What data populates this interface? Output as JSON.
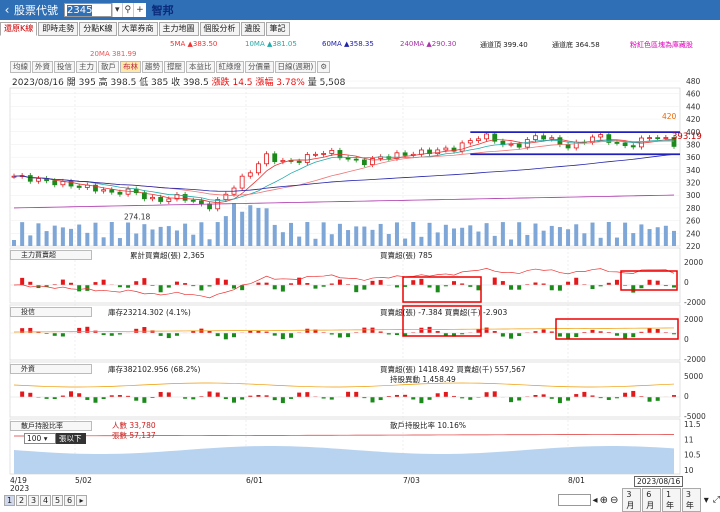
{
  "topbar": {
    "title": "股票代號",
    "code": "2345",
    "stock_name": "智邦"
  },
  "tabs": [
    "還原K線",
    "即時走勢",
    "分點K線",
    "大單券商",
    "主力地圖",
    "個股分析",
    "遺股",
    "筆記"
  ],
  "ma_legend": {
    "ma5": "5MA ▲383.50",
    "ma10": "10MA ▲381.05",
    "ma20": "20MA 381.99",
    "ma60": "60MA ▲358.35",
    "ma240": "240MA ▲290.30",
    "upper": "通道頂 399.40",
    "lower": "通道底 364.58",
    "note": "粉紅色區塊為庫藏股"
  },
  "toolbar": [
    "均線",
    "外資",
    "投信",
    "主力",
    "散戶",
    "布林",
    "趨勢",
    "撐壓",
    "本益比",
    "紅綠燈",
    "分價量",
    "日線(週期)"
  ],
  "quote": {
    "date": "2023/08/16",
    "open": "開 395",
    "high": "高 398.5",
    "low": "低 385",
    "close": "收 398.5",
    "change": "漲跌 14.5",
    "pct": "漲幅 3.78%",
    "vol": "量 5,508"
  },
  "price_labels": {
    "last": "393.19",
    "high_mark": "420",
    "low_mark": "274.18"
  },
  "price_axis": [
    "480",
    "460",
    "440",
    "420",
    "400",
    "380",
    "360",
    "340",
    "320",
    "300",
    "280",
    "260",
    "240",
    "220"
  ],
  "panel1": {
    "name": "主力買賣超",
    "legend1": "累計買賣超(張) 2,365",
    "legend2": "買賣超(張) 785",
    "axis": [
      "2000",
      "0",
      "-2000"
    ]
  },
  "panel2": {
    "name": "投信",
    "legend1": "庫存23214.302 (4.1%)",
    "legend2": "買賣超(張) -7.384  買賣超(千) -2.903",
    "axis": [
      "2000",
      "0",
      "-2000"
    ]
  },
  "panel3": {
    "name": "外資",
    "legend1": "庫存382102.956 (68.2%)",
    "legend2": "買賣超(張) 1418.492  買賣超(千) 557,567",
    "legend3": "持股異動 1,458.49",
    "axis": [
      "5000",
      "0",
      "-5000"
    ]
  },
  "panel4": {
    "name": "散戶持股比率",
    "legend1": "人數 33,780",
    "legend2": "張數 57,137",
    "legend3": "散戶持股比率 10.16%",
    "select": "100",
    "select_label": "張以下",
    "axis": [
      "11.5",
      "11",
      "10.5",
      "10"
    ]
  },
  "x_axis": {
    "d1": "4/19",
    "d1y": "2023",
    "d2": "5/02",
    "d3": "6/01",
    "d4": "7/03",
    "d5": "8/01",
    "d6": "2023/08/16"
  },
  "pages": [
    "1",
    "2",
    "3",
    "4",
    "5",
    "6"
  ],
  "periods": [
    "3月",
    "6月",
    "1年",
    "3年"
  ],
  "colors": {
    "up": "#e4181b",
    "down": "#1b8a1b",
    "channel": "#2020c0",
    "volume": "#7ea6d6"
  }
}
